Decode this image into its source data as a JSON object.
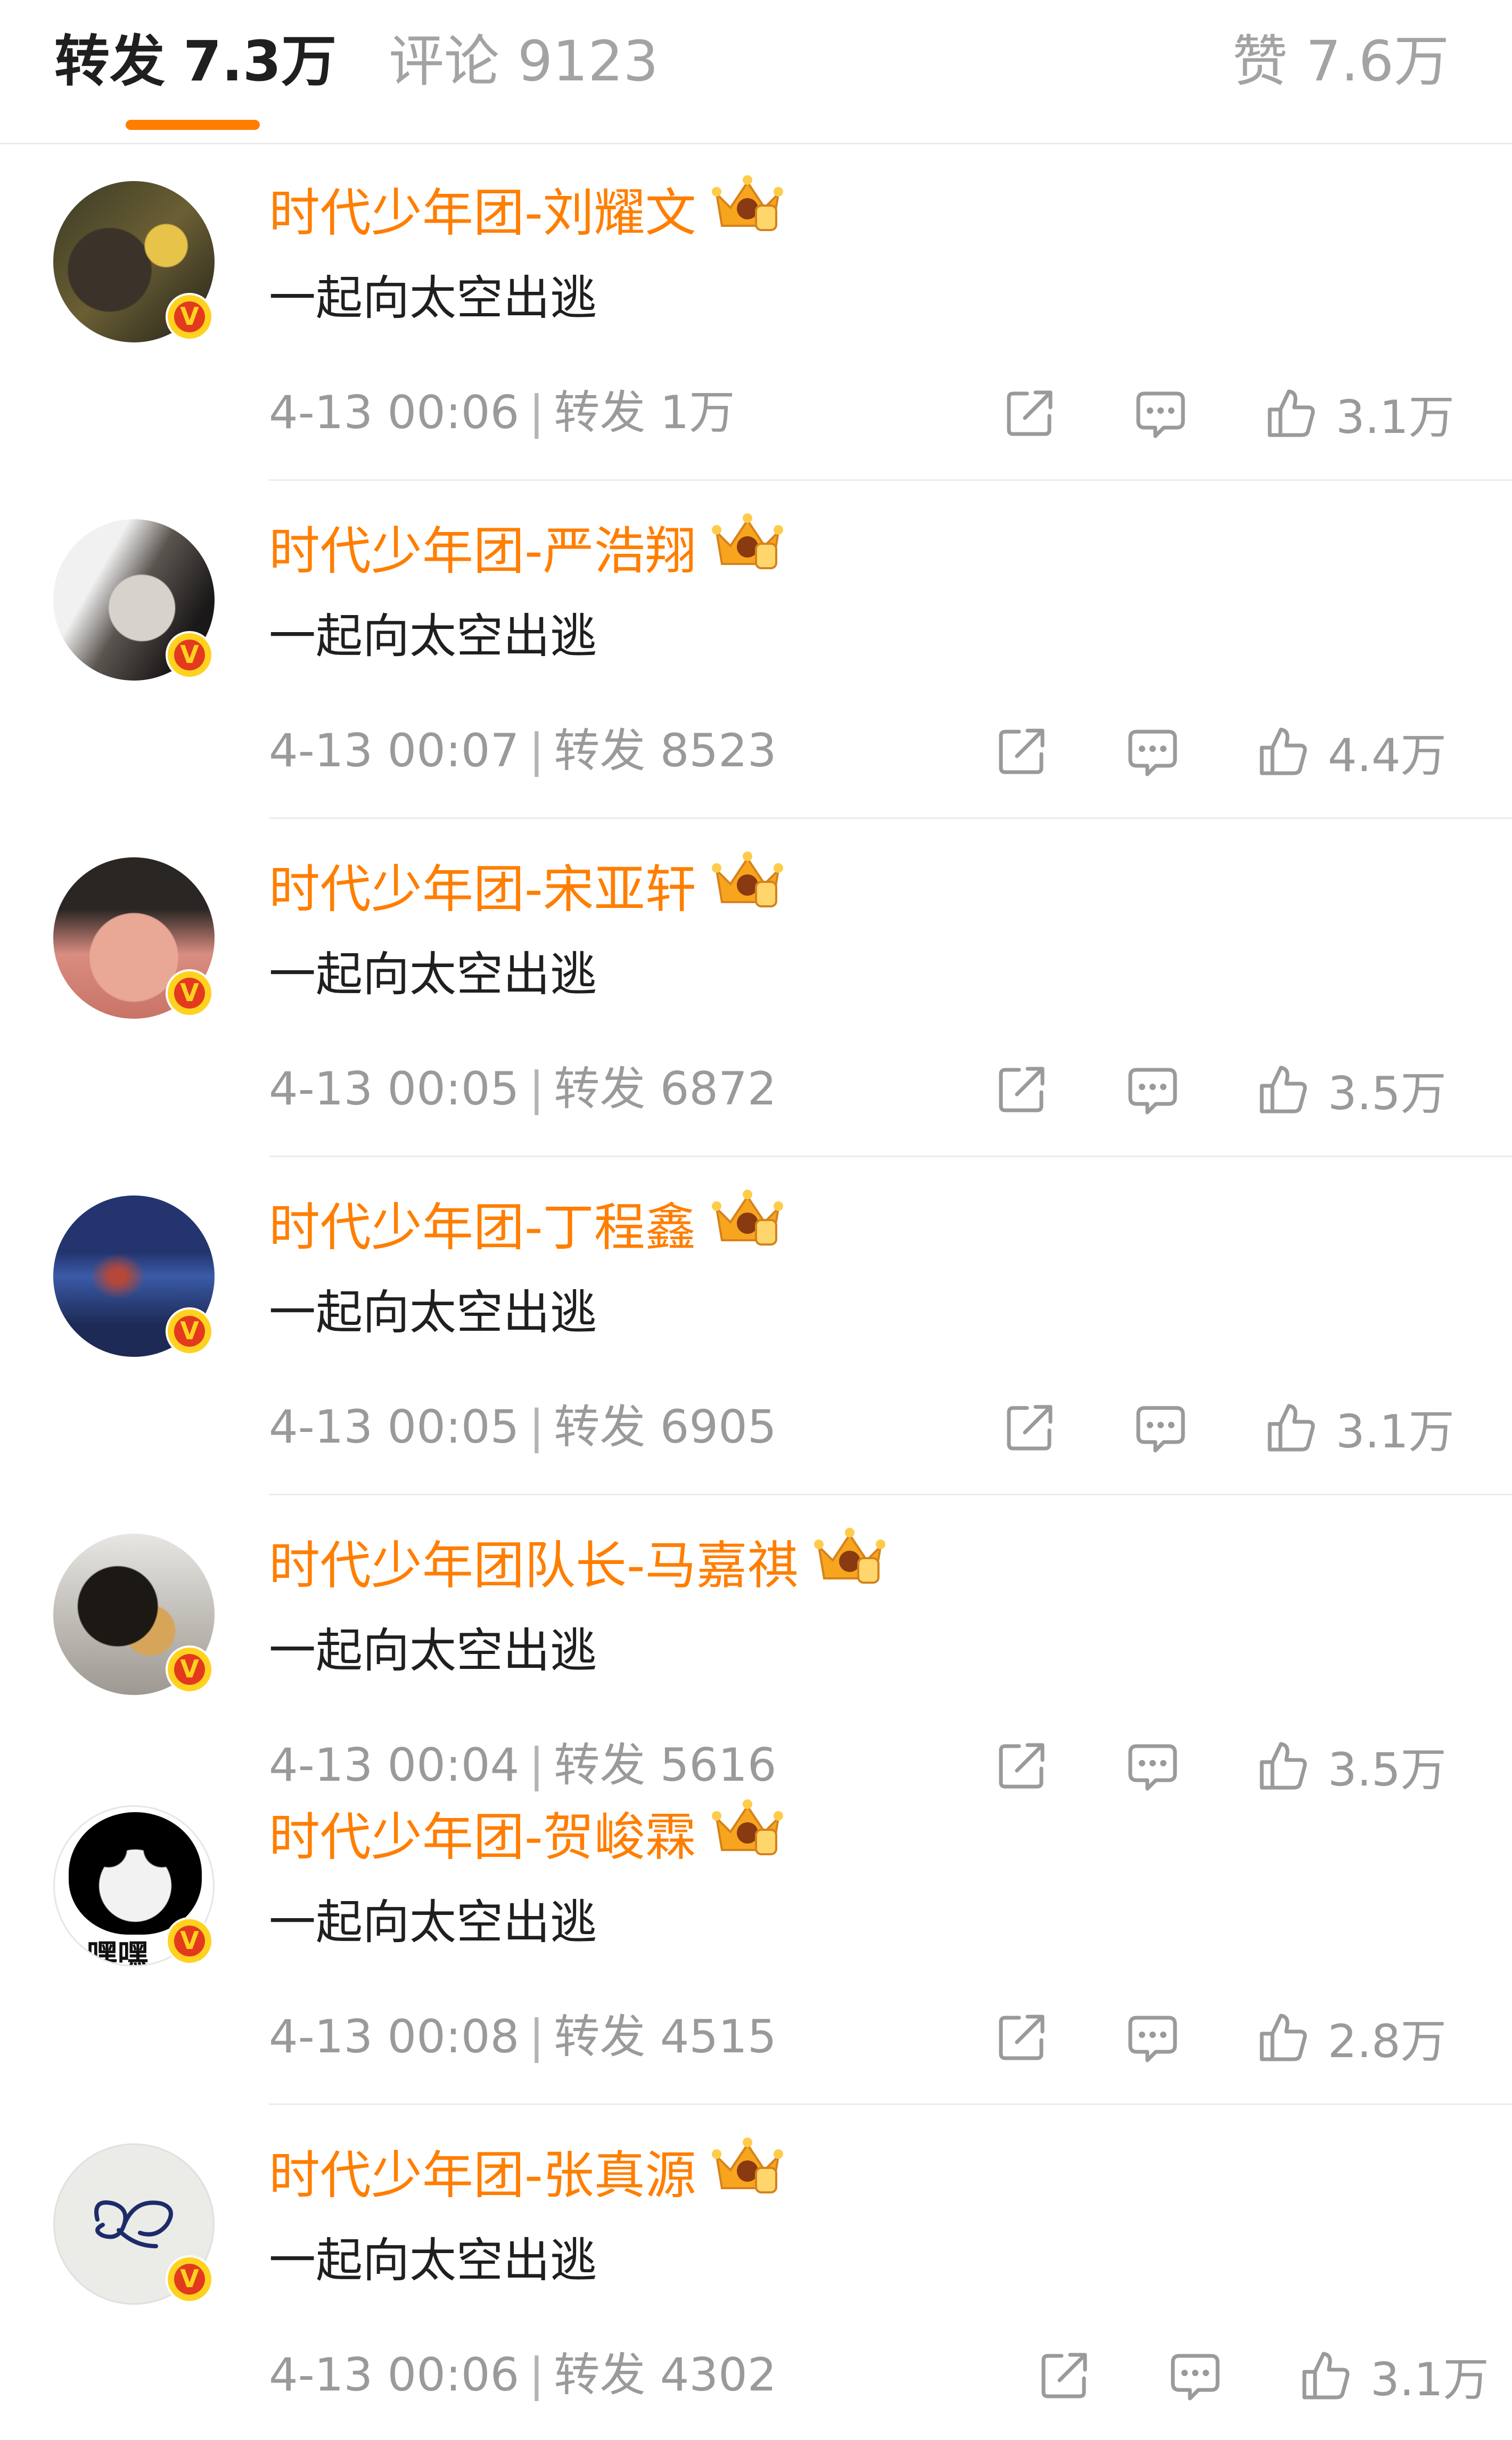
{
  "tabs": {
    "repost": {
      "label": "转发",
      "count": "7.3万"
    },
    "comment": {
      "label": "评论",
      "count": "9123"
    },
    "like": {
      "label": "赞",
      "count": "7.6万"
    }
  },
  "colors": {
    "accent": "#ff7e00",
    "name": "#ff7e00",
    "meta": "#9a9a9a",
    "text": "#1f1f1f"
  },
  "repost_label": "转发",
  "items": [
    {
      "user": "时代少年团-刘耀文",
      "text": "一起向太空出逃",
      "time": "4-13 00:06",
      "repost_count": "1万",
      "likes": "3.1万"
    },
    {
      "user": "时代少年团-严浩翔",
      "text": "一起向太空出逃",
      "time": "4-13 00:07",
      "repost_count": "8523",
      "likes": "4.4万"
    },
    {
      "user": "时代少年团-宋亚轩",
      "text": "一起向太空出逃",
      "time": "4-13 00:05",
      "repost_count": "6872",
      "likes": "3.5万"
    },
    {
      "user": "时代少年团-丁程鑫",
      "text": "一起向太空出逃",
      "time": "4-13 00:05",
      "repost_count": "6905",
      "likes": "3.1万"
    },
    {
      "user": "时代少年团队长-马嘉祺",
      "text": "一起向太空出逃",
      "time": "4-13 00:04",
      "repost_count": "5616",
      "likes": "3.5万"
    },
    {
      "user": "时代少年团-贺峻霖",
      "text": "一起向太空出逃",
      "time": "4-13 00:08",
      "repost_count": "4515",
      "likes": "2.8万",
      "avatar_caption": "嘿嘿"
    },
    {
      "user": "时代少年团-张真源",
      "text": "一起向太空出逃",
      "time": "4-13 00:06",
      "repost_count": "4302",
      "likes": "3.1万"
    }
  ],
  "icons": {
    "verified": "verified-v-icon",
    "crown": "crown-icon",
    "share": "share-icon",
    "comment": "comment-icon",
    "like": "thumbs-up-icon"
  },
  "verified_mark": "V"
}
